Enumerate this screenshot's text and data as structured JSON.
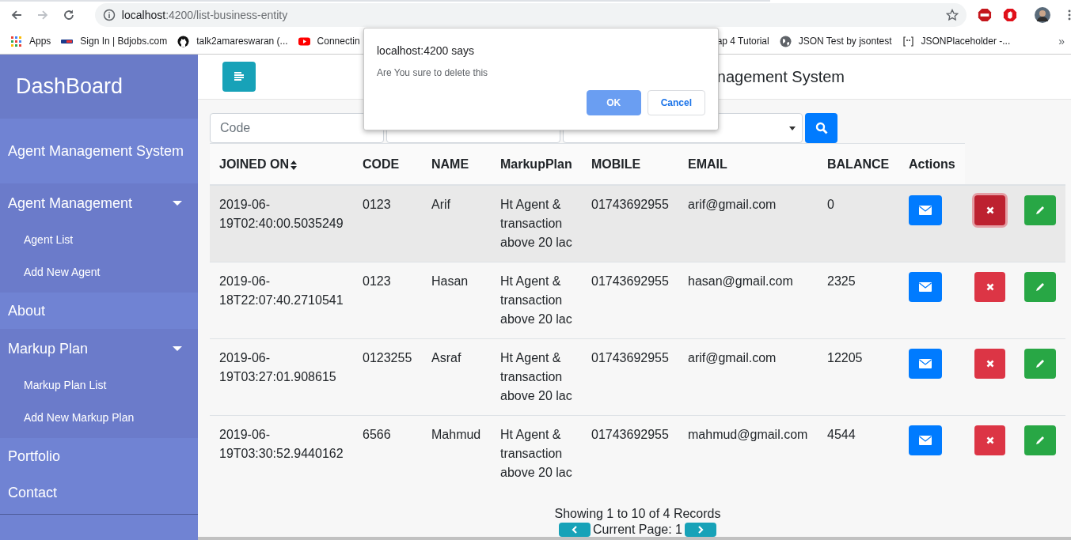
{
  "browser": {
    "url": {
      "host": "localhost",
      "path": ":4200/list-business-entity"
    },
    "bookmarks": [
      {
        "kind": "apps",
        "label": "Apps"
      },
      {
        "kind": "bdjobs",
        "label": "Sign In | Bdjobs.com"
      },
      {
        "kind": "github",
        "label": "talk2amareswaran (..."
      },
      {
        "kind": "youtube",
        "label": "Connectin"
      },
      {
        "kind": "plain",
        "label": "ap 4 Tutorial"
      },
      {
        "kind": "globe",
        "label": "JSON Test by jsontest"
      },
      {
        "kind": "placeholder",
        "label": "JSONPlaceholder -..."
      }
    ],
    "more": "»"
  },
  "sidebar": {
    "title": "DashBoard",
    "items": [
      {
        "kind": "section",
        "label": "Agent Management System"
      },
      {
        "kind": "group",
        "label": "Agent Management",
        "expanded": true,
        "children": [
          {
            "label": "Agent List"
          },
          {
            "label": "Add New Agent"
          }
        ]
      },
      {
        "kind": "link",
        "label": "About"
      },
      {
        "kind": "group",
        "label": "Markup Plan",
        "expanded": true,
        "children": [
          {
            "label": "Markup Plan List"
          },
          {
            "label": "Add New Markup Plan"
          }
        ]
      },
      {
        "kind": "link",
        "label": "Portfolio"
      },
      {
        "kind": "link",
        "label": "Contact"
      }
    ]
  },
  "header": {
    "title": "nagement System"
  },
  "filters": {
    "code": {
      "placeholder": "Code"
    }
  },
  "table": {
    "columns": [
      {
        "label": "JOINED ON",
        "sortable": true
      },
      {
        "label": "CODE",
        "sortable": false
      },
      {
        "label": "NAME",
        "sortable": false
      },
      {
        "label": "MarkupPlan",
        "sortable": false
      },
      {
        "label": "MOBILE",
        "sortable": false
      },
      {
        "label": "EMAIL",
        "sortable": false
      },
      {
        "label": "BALANCE",
        "sortable": false
      },
      {
        "label": "Actions",
        "sortable": false
      }
    ],
    "rows": [
      {
        "highlighted": true,
        "delete_focused": true,
        "cells": [
          "2019-06-19T02:40:00.5035249",
          "0123",
          "Arif",
          "Ht Agent & transaction above 20 lac",
          "01743692955",
          "arif@gmail.com",
          "0"
        ]
      },
      {
        "highlighted": false,
        "delete_focused": false,
        "cells": [
          "2019-06-18T22:07:40.2710541",
          "0123",
          "Hasan",
          "Ht Agent & transaction above 20 lac",
          "01743692955",
          "hasan@gmail.com",
          "2325"
        ]
      },
      {
        "highlighted": false,
        "delete_focused": false,
        "cells": [
          "2019-06-19T03:27:01.908615",
          "0123255",
          "Asraf",
          "Ht Agent & transaction above 20 lac",
          "01743692955",
          "arif@gmail.com",
          "12205"
        ]
      },
      {
        "highlighted": false,
        "delete_focused": false,
        "cells": [
          "2019-06-19T03:30:52.9440162",
          "6566",
          "Mahmud",
          "Ht Agent & transaction above 20 lac",
          "01743692955",
          "mahmud@gmail.com",
          "4544"
        ]
      }
    ]
  },
  "footer": {
    "summary": "Showing 1 to 10 of 4 Records",
    "page": "Current Page: 1"
  },
  "dialog": {
    "origin": "localhost:4200 says",
    "message": "Are You sure to delete this",
    "buttons": [
      {
        "label": "OK",
        "primary": true
      },
      {
        "label": "Cancel",
        "primary": false
      }
    ]
  }
}
